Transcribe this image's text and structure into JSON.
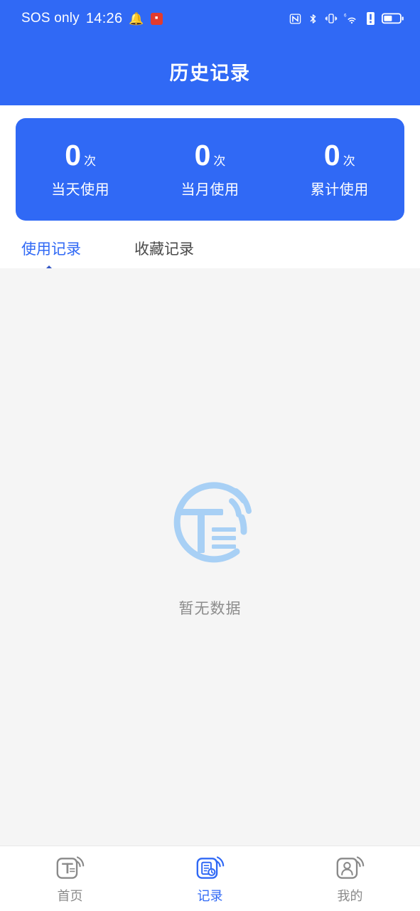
{
  "status_bar": {
    "carrier": "SOS only",
    "time": "14:26",
    "notification_icon": "bell-icon",
    "app_badge_icon": "red-app-icon",
    "right_icons": [
      "nfc-icon",
      "bluetooth-icon",
      "vibrate-icon",
      "wifi-6-icon",
      "alert-icon",
      "battery-icon"
    ]
  },
  "header": {
    "title": "历史记录"
  },
  "stats": {
    "items": [
      {
        "value": "0",
        "unit": "次",
        "label": "当天使用"
      },
      {
        "value": "0",
        "unit": "次",
        "label": "当月使用"
      },
      {
        "value": "0",
        "unit": "次",
        "label": "累计使用"
      }
    ]
  },
  "tabs": {
    "items": [
      {
        "label": "使用记录",
        "active": true
      },
      {
        "label": "收藏记录",
        "active": false
      }
    ]
  },
  "content": {
    "empty_icon": "t-signal-circle-logo",
    "empty_text": "暂无数据"
  },
  "bottom_nav": {
    "items": [
      {
        "label": "首页",
        "icon": "home-t-signal-icon",
        "active": false
      },
      {
        "label": "记录",
        "icon": "records-document-clock-icon",
        "active": true
      },
      {
        "label": "我的",
        "icon": "profile-person-icon",
        "active": false
      }
    ]
  },
  "colors": {
    "primary": "#3069f5",
    "content_bg": "#f5f5f5",
    "empty_icon": "#a8d0f5",
    "inactive_nav": "#8a8a8a"
  }
}
